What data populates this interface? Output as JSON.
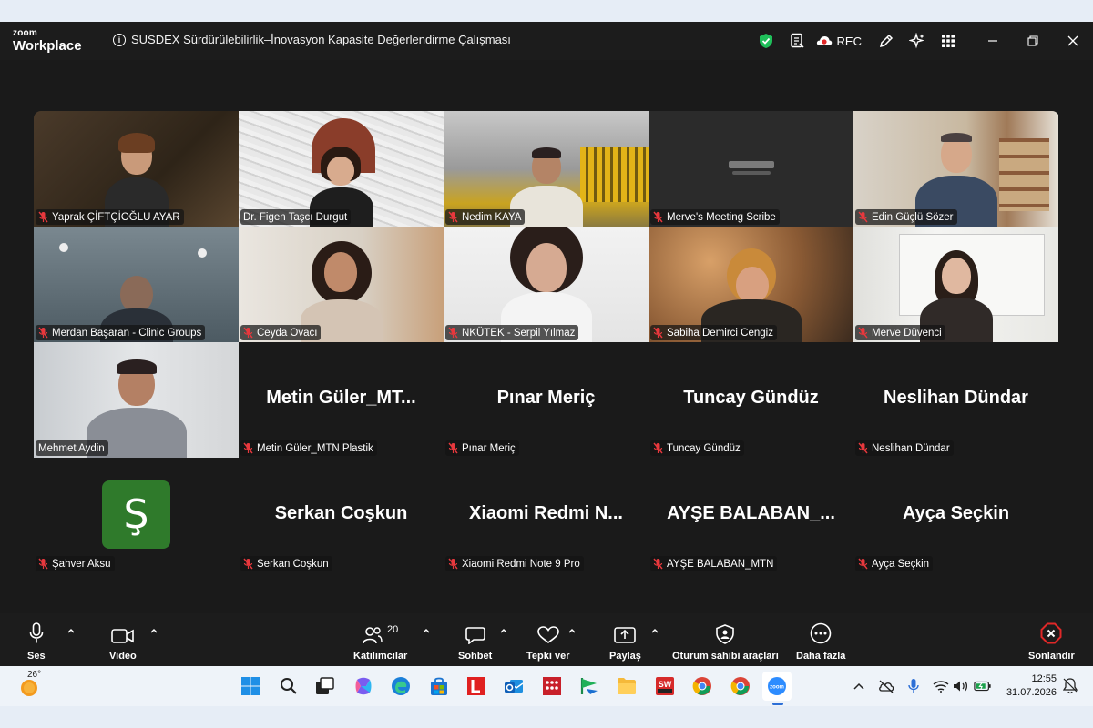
{
  "window": {
    "brand_top": "zoom",
    "brand_bottom": "Workplace",
    "title": "SUSDEX Sürdürülebilirlik–İnovasyon Kapasite Değerlendirme Çalışması",
    "rec_label": "REC"
  },
  "participants": [
    {
      "name": "Yaprak ÇİFTÇİOĞLU AYAR",
      "video": true,
      "muted": true
    },
    {
      "name": "Dr. Figen Taşcı Durgut",
      "video": true,
      "muted": false,
      "active_speaker": true
    },
    {
      "name": "Nedim KAYA",
      "video": true,
      "muted": true
    },
    {
      "name": "Merve's Meeting Scribe",
      "video": true,
      "muted": true
    },
    {
      "name": "Edin Güçlü Sözer",
      "video": true,
      "muted": true
    },
    {
      "name": "Merdan Başaran - Clinic Groups",
      "video": true,
      "muted": true
    },
    {
      "name": "Ceyda Ovacı",
      "video": true,
      "muted": true
    },
    {
      "name": "NKÜTEK - Serpil Yılmaz",
      "video": true,
      "muted": true
    },
    {
      "name": "Sabiha Demirci Cengiz",
      "video": true,
      "muted": true
    },
    {
      "name": "Merve Düvenci",
      "video": true,
      "muted": true
    },
    {
      "name": "Mehmet Aydin",
      "video": true,
      "muted": false
    },
    {
      "name": "Metin Güler_MTN Plastik",
      "display": "Metin  Güler_MT...",
      "video": false,
      "muted": true
    },
    {
      "name": "Pınar Meriç",
      "display": "Pınar Meriç",
      "video": false,
      "muted": true
    },
    {
      "name": "Tuncay Gündüz",
      "display": "Tuncay Gündüz",
      "video": false,
      "muted": true
    },
    {
      "name": "Neslihan Dündar",
      "display": "Neslihan Dündar",
      "video": false,
      "muted": true
    },
    {
      "name": "Şahver Aksu",
      "avatar_letter": "Ş",
      "avatar_color": "#2f7a2b",
      "video": false,
      "muted": true
    },
    {
      "name": "Serkan Coşkun",
      "display": "Serkan Coşkun",
      "video": false,
      "muted": true
    },
    {
      "name": "Xiaomi Redmi Note 9 Pro",
      "display": "Xiaomi  Redmi  N...",
      "video": false,
      "muted": true
    },
    {
      "name": "AYŞE BALABAN_MTN",
      "display": "AYŞE  BALABAN_...",
      "video": false,
      "muted": true
    },
    {
      "name": "Ayça Seçkin",
      "display": "Ayça Seçkin",
      "video": false,
      "muted": true
    }
  ],
  "toolbar": {
    "audio": "Ses",
    "video": "Video",
    "participants": "Katılımcılar",
    "participants_count": "20",
    "chat": "Sohbet",
    "reactions": "Tepki ver",
    "share": "Paylaş",
    "host_tools": "Oturum sahibi araçları",
    "more": "Daha fazla",
    "end": "Sonlandır"
  },
  "taskbar": {
    "temperature": "26°",
    "time": "12:55",
    "date": "31.07.2026"
  },
  "colors": {
    "active_speaker": "#24d26a",
    "muted_red": "#e8383d",
    "end_red": "#e02828",
    "shield_green": "#1fbf5a"
  }
}
